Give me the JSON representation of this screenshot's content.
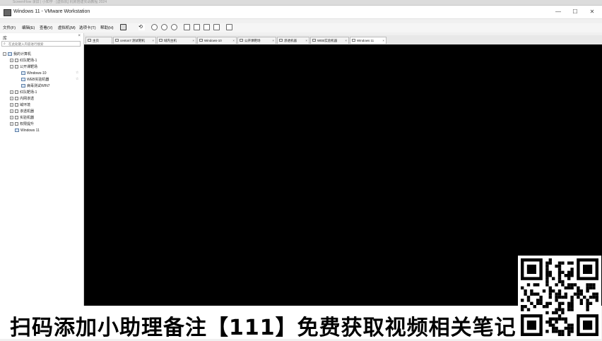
{
  "browser": {
    "tab_text": "ScreenFlow 录屏 | 小知学 · [虚拟机] 机房搭建实战教程 2024"
  },
  "window": {
    "title": "Windows 11 - VMware Workstation",
    "minimize": "—",
    "maximize": "☐",
    "close": "✕"
  },
  "menu": {
    "items": [
      "文件(F)",
      "编辑(E)",
      "查看(V)",
      "虚拟机(M)",
      "选项卡(T)",
      "帮助(H)"
    ]
  },
  "toolbar": {
    "icons": [
      "pause-icon",
      "send-ctrl-alt-del-icon",
      "snapshot-icon",
      "revert-snapshot-icon",
      "manage-snapshots-icon",
      "full-screen-icon",
      "unity-icon",
      "console-view-icon",
      "stretch-icon",
      "view-switch-icon"
    ]
  },
  "library": {
    "title": "库",
    "close": "×",
    "search_placeholder": "在此处键入内容进行搜索",
    "tree": [
      {
        "label": "我的计算机",
        "indent": 0,
        "expander": "-",
        "icon": "computer"
      },
      {
        "label": "红队靶场-1",
        "indent": 1,
        "expander": "+",
        "icon": "folder"
      },
      {
        "label": "公开课靶场",
        "indent": 1,
        "expander": "-",
        "icon": "folder"
      },
      {
        "label": "Windows-10",
        "indent": 2,
        "expander": "",
        "icon": "vm",
        "star": true
      },
      {
        "label": "WEB实验机器",
        "indent": 2,
        "expander": "",
        "icon": "vm",
        "star": true
      },
      {
        "label": "病毒测试WIN7",
        "indent": 2,
        "expander": "",
        "icon": "vm"
      },
      {
        "label": "红队靶场-1",
        "indent": 1,
        "expander": "+",
        "icon": "folder"
      },
      {
        "label": "内网渗透",
        "indent": 1,
        "expander": "+",
        "icon": "folder"
      },
      {
        "label": "域环境",
        "indent": 1,
        "expander": "+",
        "icon": "folder"
      },
      {
        "label": "渗透机器",
        "indent": 1,
        "expander": "+",
        "icon": "folder"
      },
      {
        "label": "实验机器",
        "indent": 1,
        "expander": "+",
        "icon": "folder"
      },
      {
        "label": "权限提升",
        "indent": 1,
        "expander": "+",
        "icon": "folder"
      },
      {
        "label": "Windows 11",
        "indent": 1,
        "expander": "",
        "icon": "vm"
      }
    ]
  },
  "tabs": [
    {
      "label": "主页",
      "active": false
    },
    {
      "label": "centos7 测试靶机",
      "active": false
    },
    {
      "label": "域内主机",
      "active": false
    },
    {
      "label": "Windows-10",
      "active": false
    },
    {
      "label": "公开课靶场",
      "active": false
    },
    {
      "label": "渗透机器",
      "active": false
    },
    {
      "label": "WEB实验机器",
      "active": false
    },
    {
      "label": "Windows 11",
      "active": true
    }
  ],
  "banner": {
    "text": "扫码添加小助理备注【111】免费获取视频相关笔记"
  },
  "colors": {
    "viewport": "#000000",
    "banner_bg": "#ffffff",
    "banner_text": "#000000"
  }
}
